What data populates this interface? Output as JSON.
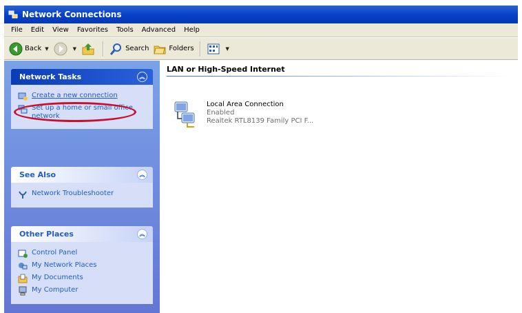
{
  "window": {
    "title": "Network Connections"
  },
  "menu": [
    "File",
    "Edit",
    "View",
    "Favorites",
    "Tools",
    "Advanced",
    "Help"
  ],
  "toolbar": {
    "back": "Back",
    "search": "Search",
    "folders": "Folders"
  },
  "sidebar": {
    "network_tasks": {
      "title": "Network Tasks",
      "items": [
        "Create a new connection",
        "Set up a home or small office network"
      ]
    },
    "see_also": {
      "title": "See Also",
      "items": [
        "Network Troubleshooter"
      ]
    },
    "other_places": {
      "title": "Other Places",
      "items": [
        "Control Panel",
        "My Network Places",
        "My Documents",
        "My Computer"
      ]
    }
  },
  "content": {
    "group_title": "LAN or High-Speed Internet",
    "connection": {
      "name": "Local Area Connection",
      "status": "Enabled",
      "device": "Realtek RTL8139 Family PCI F..."
    }
  },
  "colors": {
    "titlebar": "#0842c9",
    "link": "#215dc6",
    "highlight": "#c8102e"
  }
}
